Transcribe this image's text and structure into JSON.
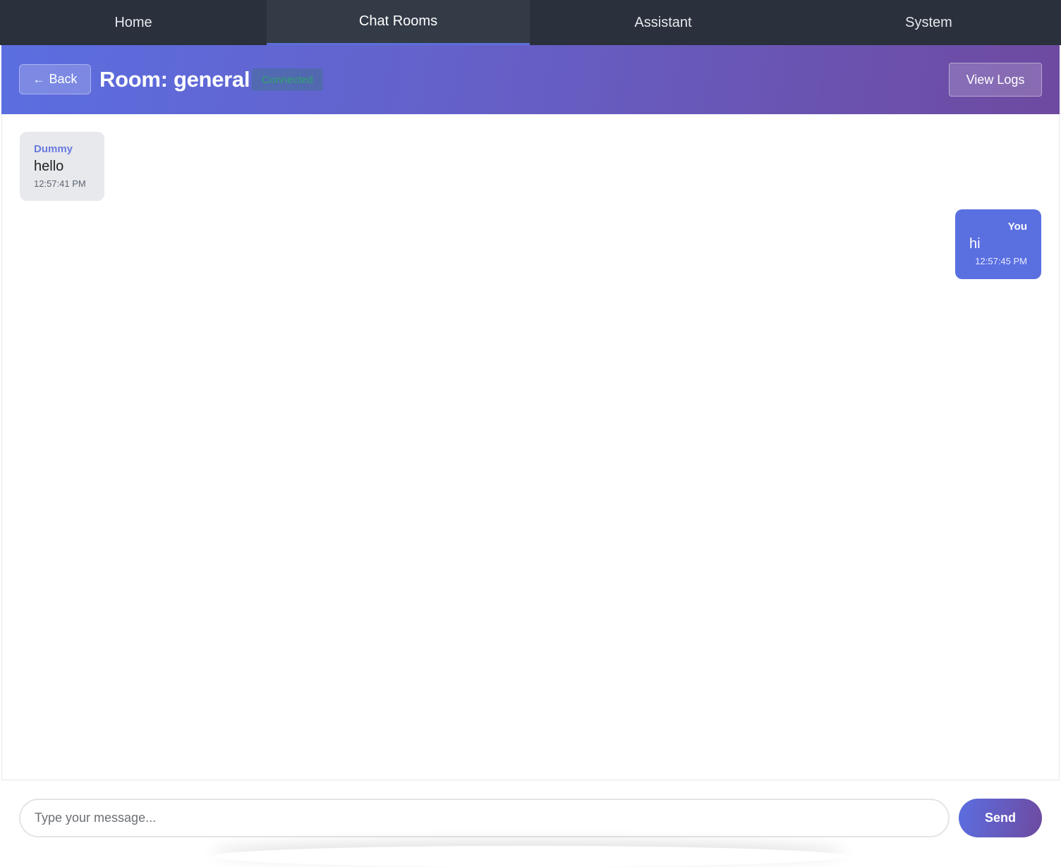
{
  "nav": {
    "tabs": [
      {
        "label": "Home",
        "active": false
      },
      {
        "label": "Chat Rooms",
        "active": true
      },
      {
        "label": "Assistant",
        "active": false
      },
      {
        "label": "System",
        "active": false
      }
    ]
  },
  "room": {
    "back_label": "Back",
    "back_icon": "arrow-left-icon",
    "title": "Room: general",
    "status": "Connected",
    "view_logs_label": "View Logs"
  },
  "messages": [
    {
      "sender": "Dummy",
      "text": "hello",
      "time": "12:57:41 PM",
      "own": false
    },
    {
      "sender": "You",
      "text": "hi",
      "time": "12:57:45 PM",
      "own": true
    }
  ],
  "composer": {
    "placeholder": "Type your message...",
    "value": "",
    "send_label": "Send"
  },
  "colors": {
    "nav_bg": "#2a303c",
    "accent": "#5a6fe0",
    "header_gradient_start": "#5b6ee0",
    "header_gradient_end": "#6e4aa0",
    "status_text": "#2ca56a"
  }
}
